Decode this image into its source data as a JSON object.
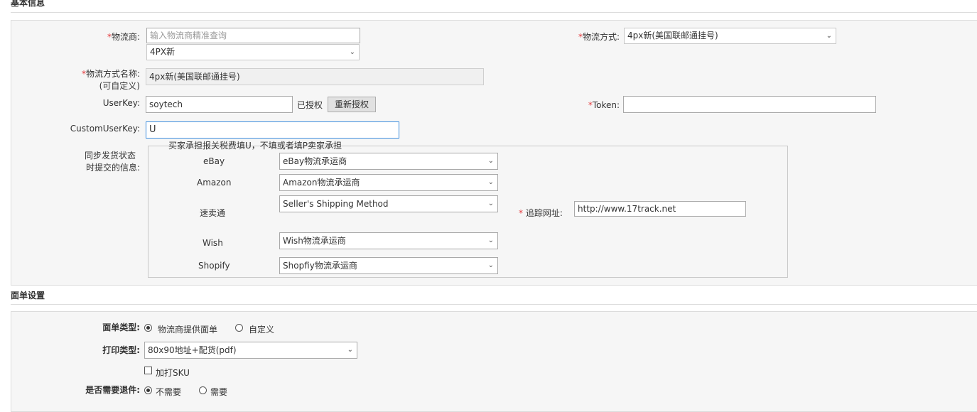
{
  "basic_info": {
    "title": "基本信息",
    "carrier": {
      "label": "物流商:",
      "search_placeholder": "输入物流商精准查询",
      "selected": "4PX新"
    },
    "shipping_method": {
      "label": "物流方式:",
      "selected": "4px新(美国联邮通挂号)"
    },
    "method_name": {
      "label_line1": "物流方式名称:",
      "label_line2": "(可自定义)",
      "value": "4px新(美国联邮通挂号)"
    },
    "userkey": {
      "label": "UserKey:",
      "value": "soytech",
      "status": "已授权",
      "reauth_button": "重新授权"
    },
    "token": {
      "label": "Token:",
      "value": ""
    },
    "custom_userkey": {
      "label": "CustomUserKey:",
      "value": "U",
      "note": "买家承担报关税费填U，不填或者填P卖家承担"
    },
    "sync": {
      "label_line1": "同步发货状态",
      "label_line2": "时提交的信息:",
      "platforms": [
        {
          "name": "eBay",
          "value": "eBay物流承运商"
        },
        {
          "name": "Amazon",
          "value": "Amazon物流承运商"
        },
        {
          "name": "速卖通",
          "value": "Seller's Shipping Method"
        },
        {
          "name": "Wish",
          "value": "Wish物流承运商"
        },
        {
          "name": "Shopify",
          "value": "Shopfiy物流承运商"
        }
      ],
      "tracking": {
        "label": "追踪网址:",
        "value": "http://www.17track.net"
      }
    },
    "required_mark": "*"
  },
  "label_settings": {
    "title": "面单设置",
    "label_type": {
      "label": "面单类型:",
      "options": [
        "物流商提供面单",
        "自定义"
      ],
      "selected_index": 0
    },
    "print_type": {
      "label": "打印类型:",
      "selected": "80x90地址+配货(pdf)"
    },
    "print_sku": {
      "label": "加打SKU",
      "checked": false
    },
    "return_needed": {
      "label": "是否需要退件:",
      "options": [
        "不需要",
        "需要"
      ],
      "selected_index": 0
    }
  },
  "icons": {
    "chevron": "chevron-down-icon"
  }
}
